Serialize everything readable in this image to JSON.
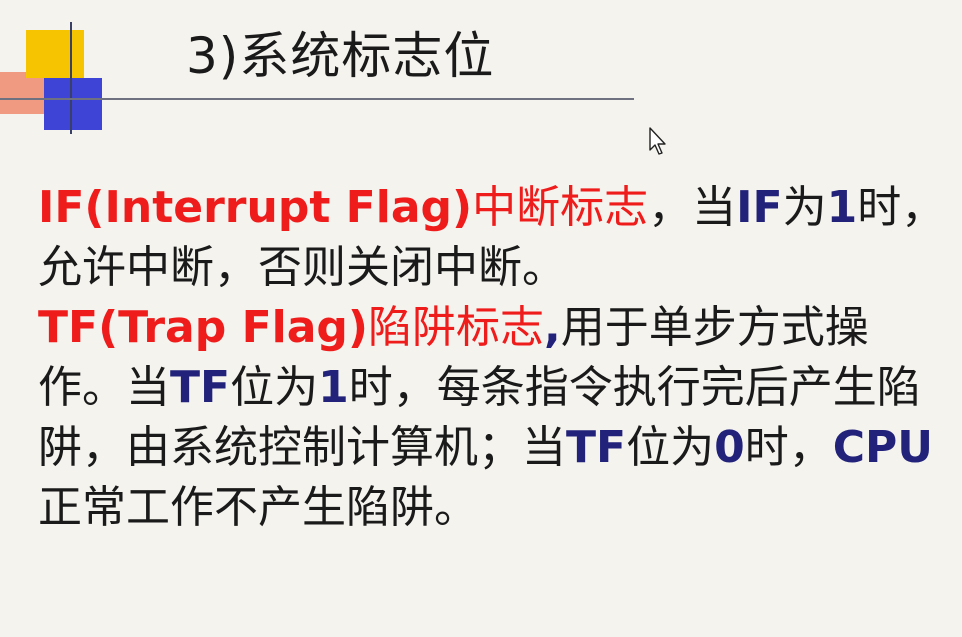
{
  "title": "3)系统标志位",
  "paragraphs": {
    "if": {
      "term": "IF(Interrupt Flag)",
      "term_cn": "中断标志",
      "text1": "，当",
      "flag1": "IF",
      "text2": "为",
      "num1": "1",
      "text3": "时，允许中断，否则关闭中断。"
    },
    "tf": {
      "term": "TF(Trap Flag)",
      "term_cn": "陷阱标志",
      "comma": ",",
      "text1": "用于单步方式操作。当",
      "flag1": "TF",
      "text2": "位为",
      "num1": "1",
      "text3": "时，每条指令执行完后产生陷阱，由系统控制计算机；当",
      "flag2": "TF",
      "text4": "位为",
      "num2": "0",
      "text5": "时，",
      "cpu": "CPU",
      "text6": "正常工作不产生陷阱。"
    }
  },
  "colors": {
    "term": "#ef1c1c",
    "keyword": "#22227a",
    "text": "#1a1a1a",
    "background": "#f4f3ee"
  },
  "icons": [
    "mouse-pointer-icon"
  ]
}
